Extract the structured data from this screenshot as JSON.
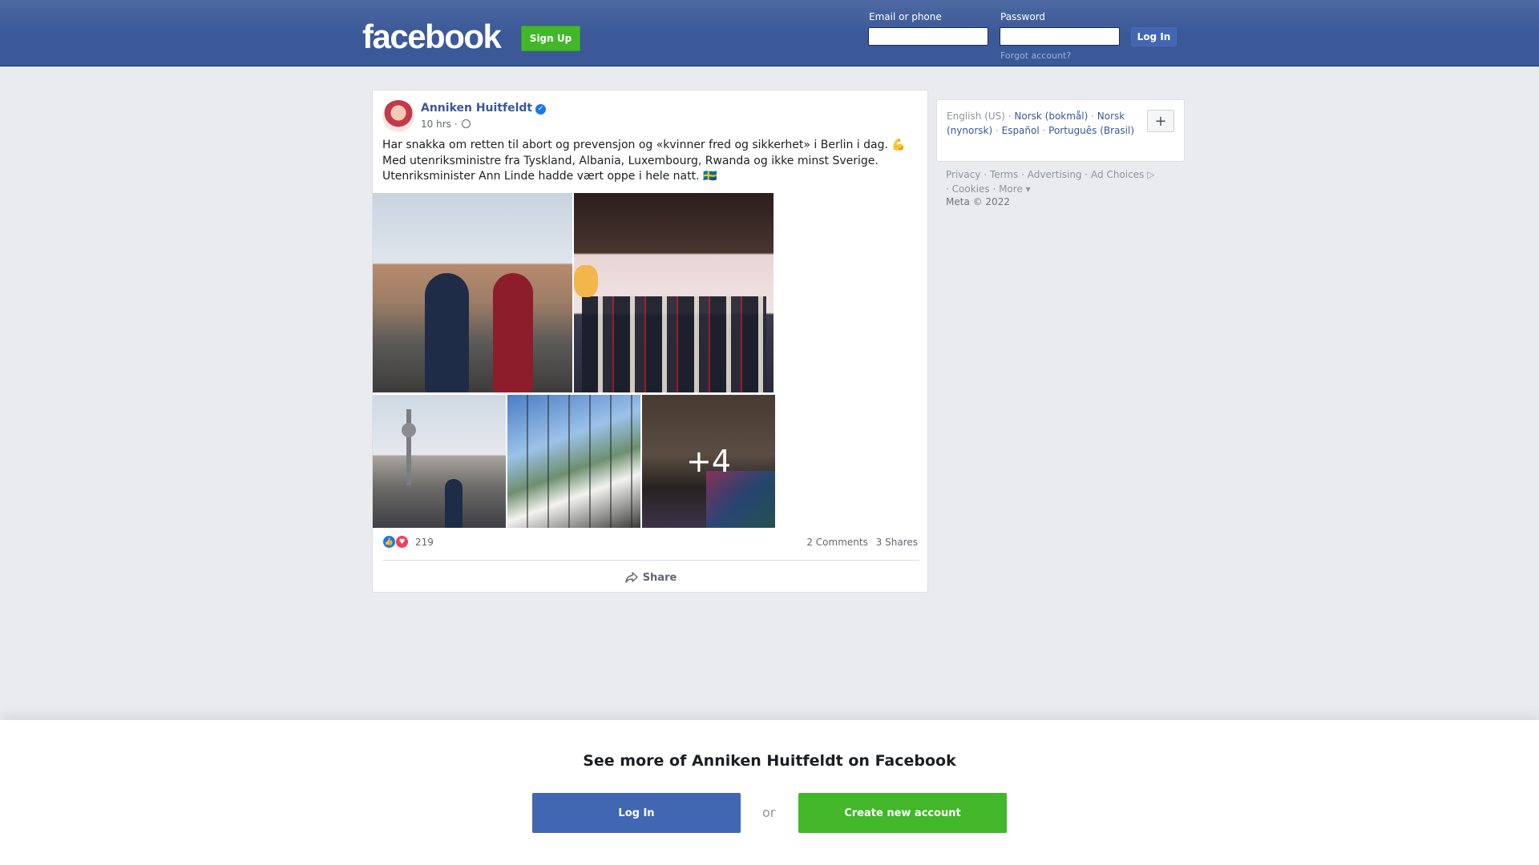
{
  "header": {
    "logo": "facebook",
    "signup_label": "Sign Up",
    "email_label": "Email or phone",
    "password_label": "Password",
    "login_label": "Log In",
    "forgot_label": "Forgot account?"
  },
  "post": {
    "author": "Anniken Huitfeldt",
    "time": "10 hrs",
    "text": "Har snakka om retten til abort og prevensjon og «kvinner fred og sikkerhet» i Berlin i dag. 💪 Med utenriksministre fra Tyskland, Albania, Luxembourg, Rwanda og ikke minst Sverige. Utenriksminister Ann Linde hadde vært oppe i hele natt. 🇸🇪",
    "more_photos": "+4",
    "reaction_count": "219",
    "comments": "2 Comments",
    "shares": "3 Shares",
    "share_label": "Share"
  },
  "sidebar": {
    "languages": {
      "current": "English (US)",
      "others": [
        "Norsk (bokmål)",
        "Norsk (nynorsk)",
        "Español",
        "Português (Brasil)"
      ]
    },
    "add_language_label": "+",
    "footer_links": [
      "Privacy",
      "Terms",
      "Advertising",
      "Ad Choices",
      "Cookies",
      "More"
    ],
    "copyright": "Meta © 2022"
  },
  "banner": {
    "title": "See more of Anniken Huitfeldt on Facebook",
    "login_label": "Log In",
    "or_label": "or",
    "create_label": "Create new account"
  },
  "colors": {
    "brand_blue": "#3b5998",
    "button_blue": "#4267b2",
    "green": "#42b72a",
    "link": "#385898"
  }
}
